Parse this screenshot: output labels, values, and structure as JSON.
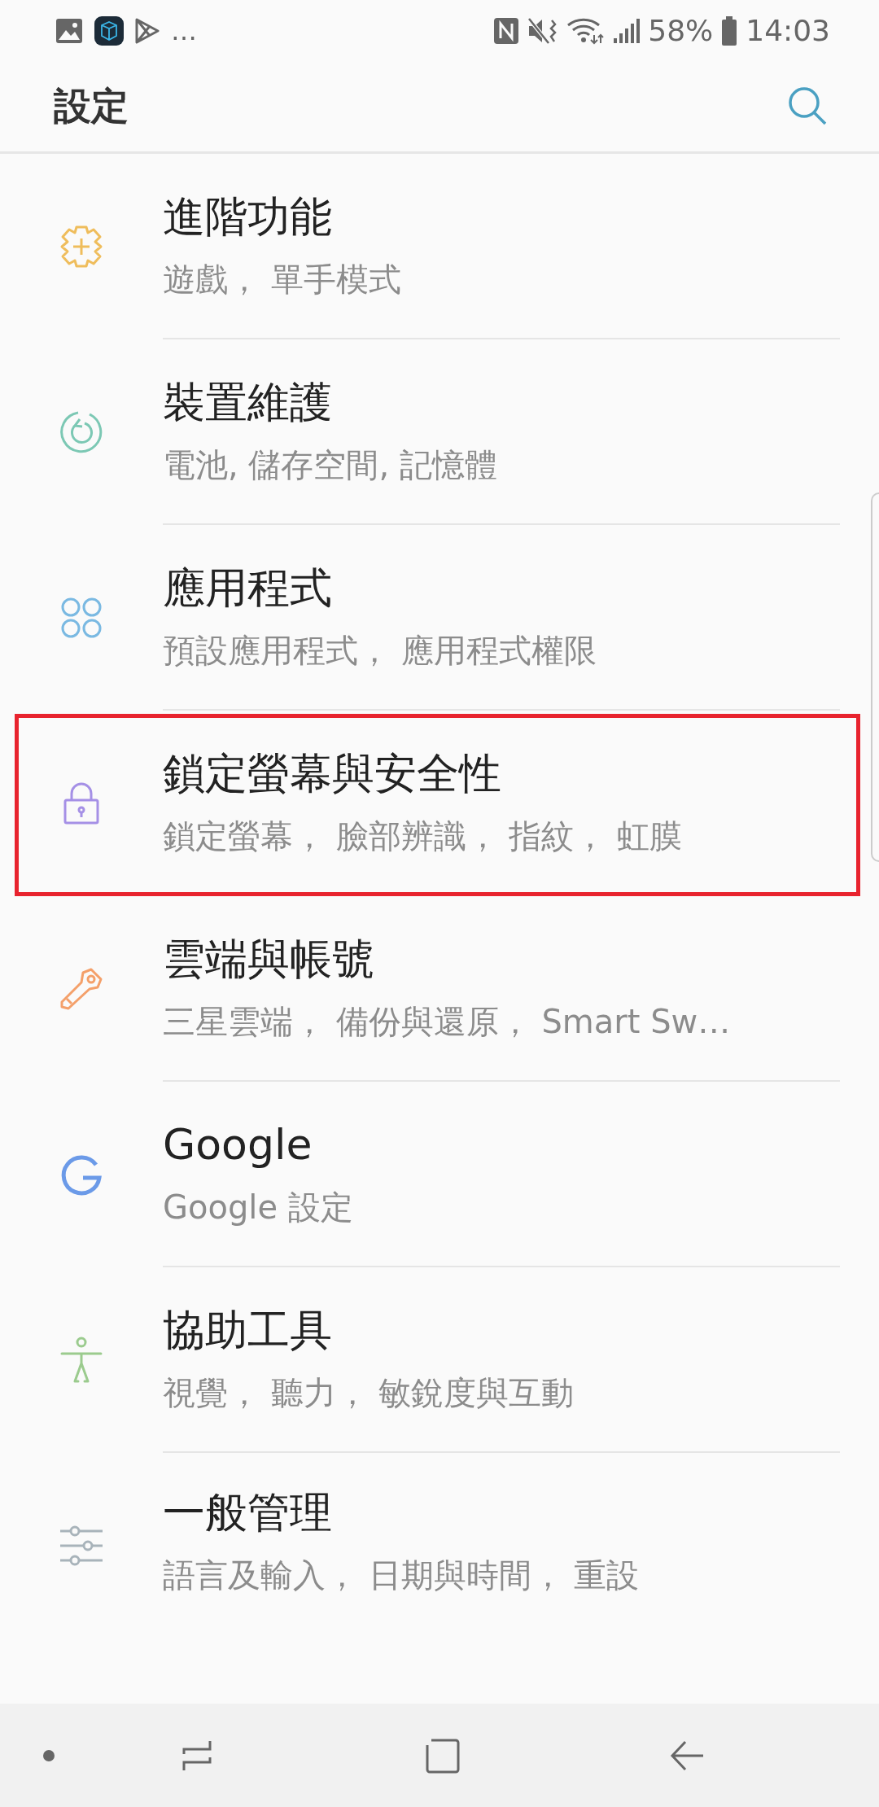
{
  "status_bar": {
    "notifications": [
      "…"
    ],
    "battery": "58%",
    "time": "14:03"
  },
  "app_bar": {
    "title": "設定"
  },
  "items": [
    {
      "title": "進階功能",
      "subtitle": "遊戲， 單手模式",
      "highlighted": false
    },
    {
      "title": "裝置維護",
      "subtitle": "電池, 儲存空間, 記憶體",
      "highlighted": false
    },
    {
      "title": "應用程式",
      "subtitle": "預設應用程式， 應用程式權限",
      "highlighted": false
    },
    {
      "title": "鎖定螢幕與安全性",
      "subtitle": "鎖定螢幕， 臉部辨識， 指紋， 虹膜",
      "highlighted": true
    },
    {
      "title": "雲端與帳號",
      "subtitle": "三星雲端， 備份與還原， Smart Sw…",
      "highlighted": false
    },
    {
      "title": "Google",
      "subtitle": "Google 設定",
      "highlighted": false
    },
    {
      "title": "協助工具",
      "subtitle": "視覺， 聽力， 敏銳度與互動",
      "highlighted": false
    },
    {
      "title": "一般管理",
      "subtitle": "語言及輸入， 日期與時間， 重設",
      "highlighted": false
    }
  ]
}
